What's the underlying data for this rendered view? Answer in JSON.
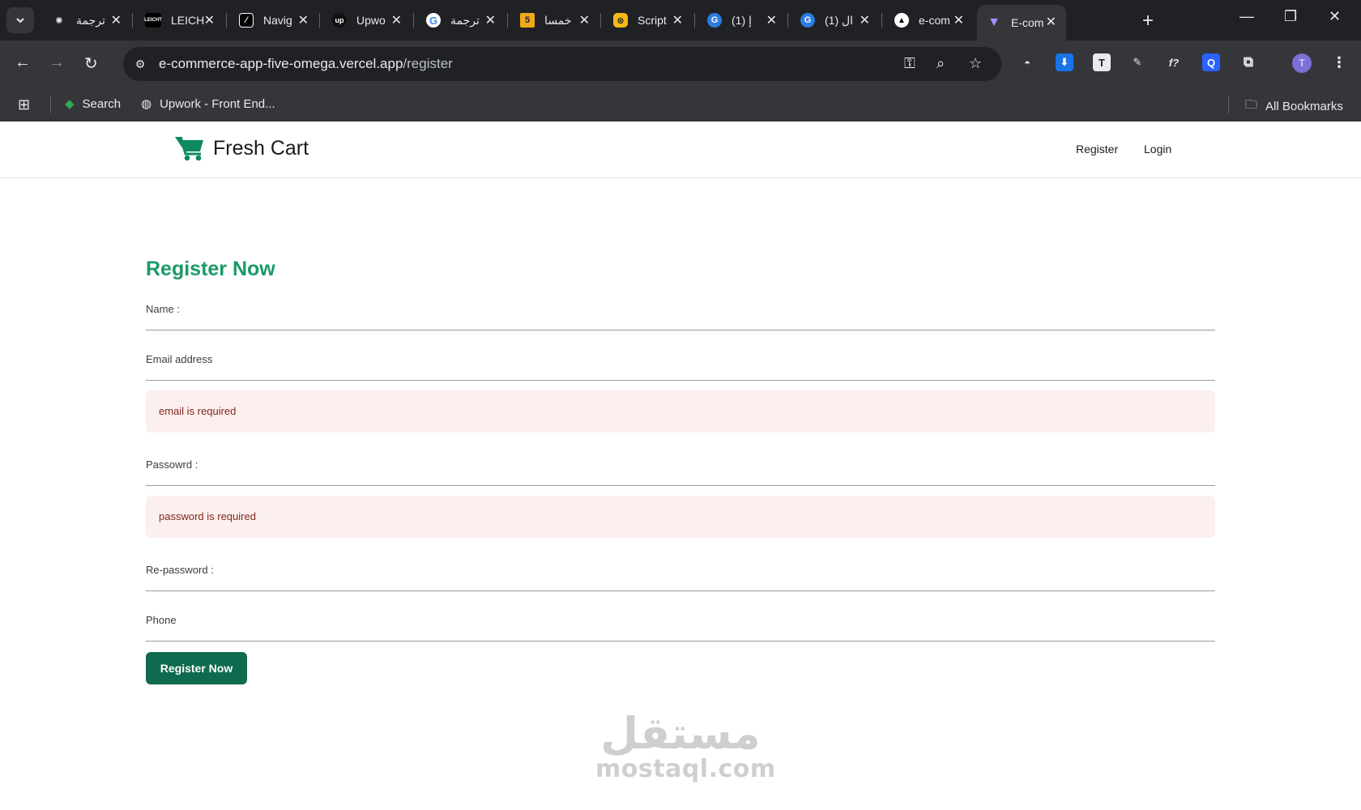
{
  "browser": {
    "tabs": [
      {
        "title": "ترجمة",
        "icon": "openai-icon"
      },
      {
        "title": "LEICH",
        "icon": "leicht-icon"
      },
      {
        "title": "Navig",
        "icon": "notion-icon"
      },
      {
        "title": "Upwo",
        "icon": "upwork-icon"
      },
      {
        "title": "ترجمة",
        "icon": "google-icon"
      },
      {
        "title": "خمسا",
        "icon": "khamsat-icon"
      },
      {
        "title": "Script",
        "icon": "script-icon"
      },
      {
        "title": "(1) إ",
        "icon": "grammarly-icon"
      },
      {
        "title": "(1) ال",
        "icon": "grammarly-icon"
      },
      {
        "title": "e-com",
        "icon": "vercel-icon"
      },
      {
        "title": "E-com",
        "icon": "vite-icon"
      }
    ],
    "url_host": "e-commerce-app-five-omega.vercel.app",
    "url_path": "/register",
    "avatar_initial": "T",
    "bookmarks": {
      "search": "Search",
      "upwork": "Upwork - Front End...",
      "all": "All Bookmarks"
    }
  },
  "navbar": {
    "brand": "Fresh Cart",
    "links": {
      "register": "Register",
      "login": "Login"
    }
  },
  "form": {
    "title": "Register Now",
    "name_label": "Name :",
    "email_label": "Email address",
    "email_error": "email is required",
    "password_label": "Passowrd :",
    "password_error": "password is required",
    "repassword_label": "Re-password :",
    "phone_label": "Phone",
    "submit": "Register Now"
  },
  "watermark": {
    "arabic": "مستقل",
    "latin": "mostaql.com"
  },
  "colors": {
    "brand_green": "#1a9a67",
    "button_green": "#0e6b4f",
    "error_bg": "#fcf0ee",
    "error_text": "#82271c"
  }
}
